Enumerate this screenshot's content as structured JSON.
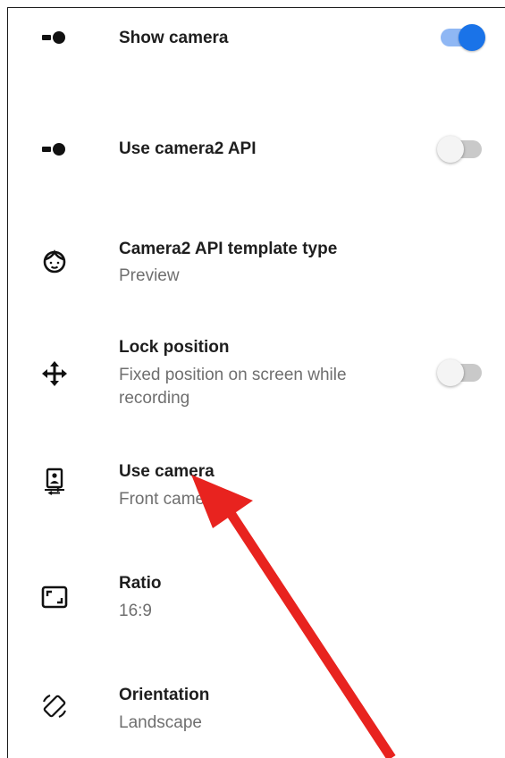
{
  "settings": [
    {
      "title": "Show camera",
      "subtitle": "",
      "icon": "toggle-dot-icon",
      "toggle": true
    },
    {
      "title": "Use camera2 API",
      "subtitle": "",
      "icon": "toggle-dot-icon",
      "toggle": false
    },
    {
      "title": "Camera2 API template type",
      "subtitle": "Preview",
      "icon": "face-icon"
    },
    {
      "title": "Lock position",
      "subtitle": "Fixed position on screen while recording",
      "icon": "move-arrows-icon",
      "toggle": false
    },
    {
      "title": "Use camera",
      "subtitle": "Front camera",
      "icon": "front-camera-icon"
    },
    {
      "title": "Ratio",
      "subtitle": "16:9",
      "icon": "aspect-ratio-icon"
    },
    {
      "title": "Orientation",
      "subtitle": "Landscape",
      "icon": "screen-rotation-icon"
    }
  ],
  "colors": {
    "accent": "#1a73e8",
    "annotation_arrow": "#e8231f"
  }
}
